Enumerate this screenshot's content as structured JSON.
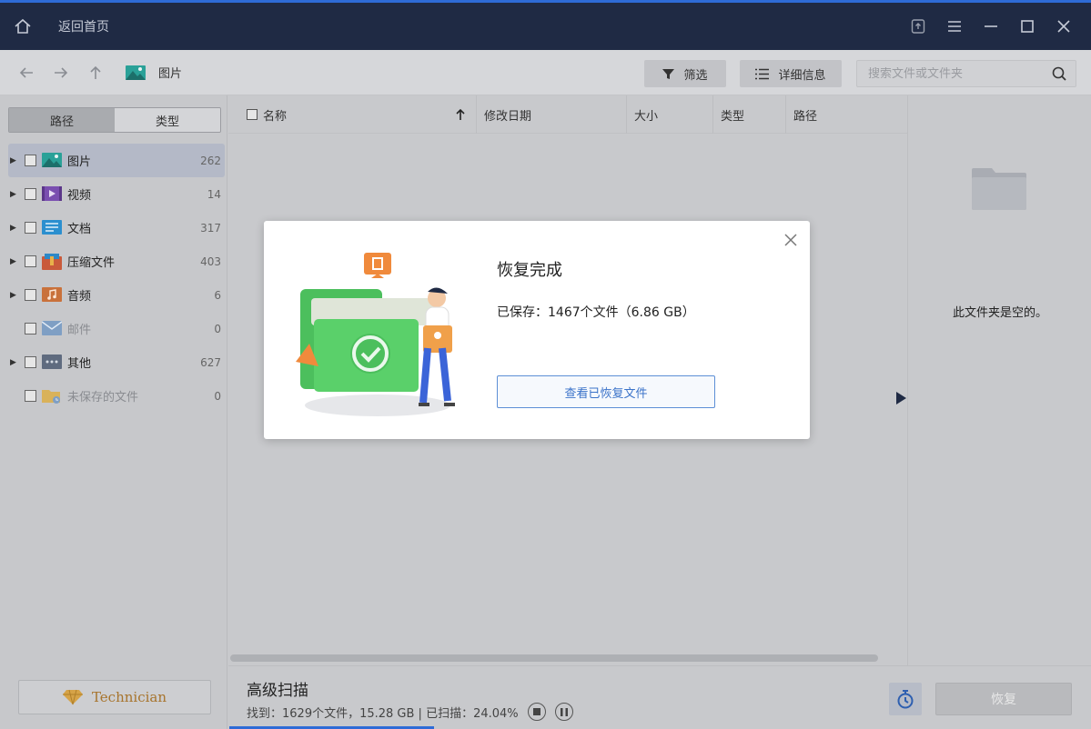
{
  "titlebar": {
    "back_home": "返回首页",
    "icons": [
      "home-icon",
      "share-icon",
      "menu-icon",
      "minimize-icon",
      "maximize-icon",
      "close-icon"
    ]
  },
  "toolbar": {
    "breadcrumb": "图片",
    "filter_label": "筛选",
    "details_label": "详细信息",
    "search_placeholder": "搜索文件或文件夹"
  },
  "sidebar": {
    "tab_path": "路径",
    "tab_type": "类型",
    "categories": [
      {
        "label": "图片",
        "count": "262",
        "selected": true
      },
      {
        "label": "视频",
        "count": "14"
      },
      {
        "label": "文档",
        "count": "317"
      },
      {
        "label": "压缩文件",
        "count": "403"
      },
      {
        "label": "音频",
        "count": "6"
      },
      {
        "label": "邮件",
        "count": "0"
      },
      {
        "label": "其他",
        "count": "627"
      },
      {
        "label": "未保存的文件",
        "count": "0"
      }
    ],
    "technician_label": "Technician"
  },
  "table": {
    "col_name": "名称",
    "col_modified": "修改日期",
    "col_size": "大小",
    "col_type": "类型",
    "col_path": "路径"
  },
  "right_pane": {
    "empty_text": "此文件夹是空的。"
  },
  "bottom": {
    "scan_title": "高级扫描",
    "scan_status": "找到：1629个文件，15.28 GB | 已扫描：24.04%",
    "scan_progress_percent": 24.04,
    "recover_label": "恢复"
  },
  "modal": {
    "title": "恢复完成",
    "saved": "已保存：1467个文件（6.86 GB）",
    "view_button": "查看已恢复文件"
  },
  "colors": {
    "titlebar_bg": "#1f2a44",
    "accent_blue": "#2e6bd6",
    "technician_gold": "#a7742d"
  }
}
